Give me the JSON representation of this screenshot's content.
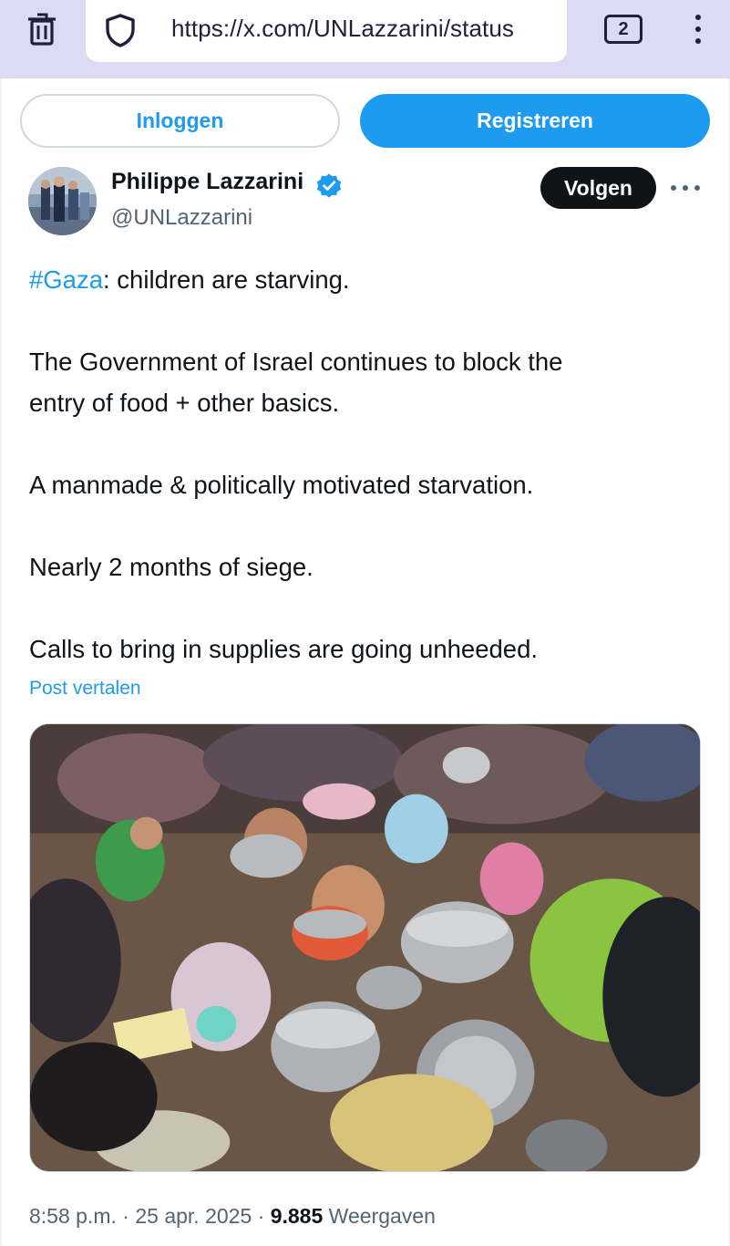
{
  "browser": {
    "url": "https://x.com/UNLazzarini/status",
    "tab_count": "2"
  },
  "auth": {
    "login_label": "Inloggen",
    "register_label": "Registreren"
  },
  "author": {
    "name": "Philippe Lazzarini",
    "handle": "@UNLazzarini",
    "follow_label": "Volgen",
    "verified": true
  },
  "tweet": {
    "hashtag": "#Gaza",
    "line1_rest": ": children are starving.",
    "line2a": "The Government of Israel continues to block the",
    "line2b": "entry of food + other basics.",
    "line3": "A manmade & politically motivated starvation.",
    "line4": "Nearly 2 months of siege.",
    "line5": "Calls to bring in supplies are going unheeded.",
    "translate_label": "Post vertalen"
  },
  "meta": {
    "time": "8:58 p.m.",
    "separator": "·",
    "date": "25 apr. 2025",
    "views_count": "9.885",
    "views_label": "Weergaven"
  },
  "colors": {
    "accent": "#1d9bf0",
    "text": "#0f1419",
    "secondary": "#536471",
    "browser_bar": "#dcdaf5"
  },
  "icons": [
    "trash-icon",
    "shield-icon",
    "tabs-counter",
    "menu-dots-icon",
    "verified-badge-icon",
    "more-dots-icon"
  ]
}
